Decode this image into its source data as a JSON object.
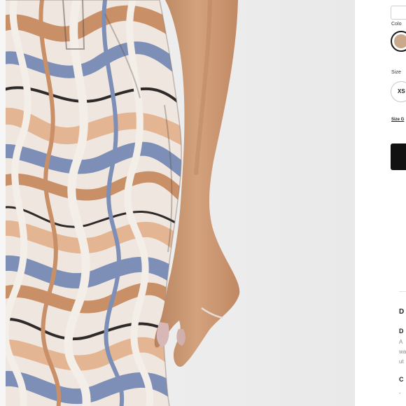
{
  "product": {
    "image_alt": "Model wearing marble swirl print denim skirt",
    "color": {
      "label": "Colo",
      "selected_hex": "#c9a98b"
    },
    "size": {
      "label": "Size",
      "options": [
        "XS"
      ]
    },
    "size_guide_label": "Size G",
    "add_to_bag_label": "",
    "details": {
      "heading": "D",
      "subheading": "D",
      "lines": [
        "A",
        "wa",
        "ut"
      ],
      "care_heading": "C",
      "care_first": "- "
    }
  },
  "colors": {
    "swatch": "#c9a98b",
    "button": "#111111",
    "print_palette": [
      "#c98f67",
      "#7d8fb6",
      "#f3eee8",
      "#2e2a2a",
      "#e4b592"
    ]
  }
}
